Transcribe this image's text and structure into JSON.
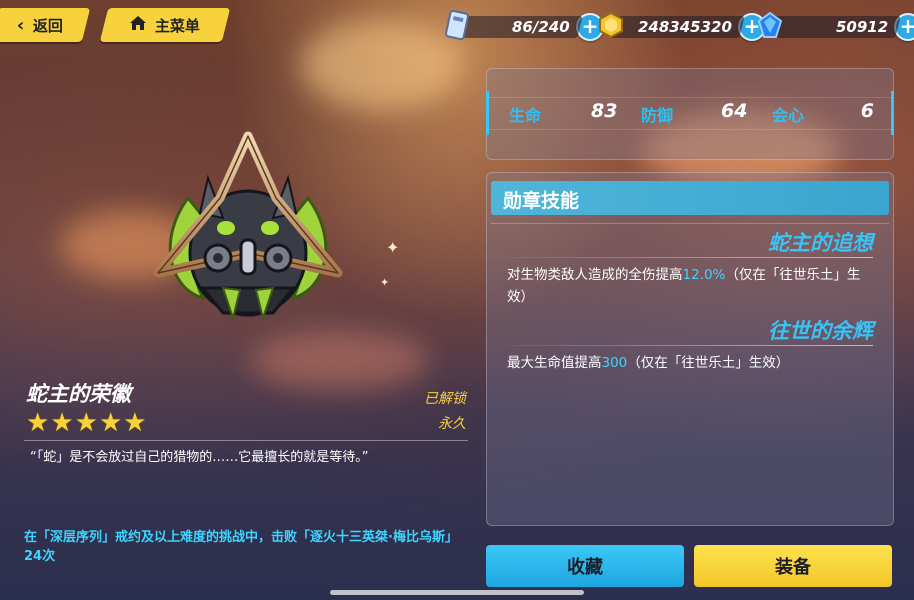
{
  "nav": {
    "back_label": "返回",
    "home_label": "主菜单"
  },
  "resources": [
    {
      "name": "stamina",
      "value": "86/240",
      "icon": "stamina-card-icon"
    },
    {
      "name": "coins",
      "value": "248345320",
      "icon": "gold-coin-icon"
    },
    {
      "name": "crystals",
      "value": "50912",
      "icon": "crystal-icon"
    }
  ],
  "stats": [
    {
      "label": "生命",
      "value": "83"
    },
    {
      "label": "防御",
      "value": "64"
    },
    {
      "label": "会心",
      "value": "6"
    }
  ],
  "skills": {
    "title": "勋章技能",
    "items": [
      {
        "name": "蛇主的追想",
        "desc_prefix": "对生物类敌人造成的全伤提高",
        "desc_highlight": "12.0%",
        "desc_suffix": "（仅在「往世乐土」生效）"
      },
      {
        "name": "往世的余辉",
        "desc_prefix": "最大生命值提高",
        "desc_highlight": "300",
        "desc_suffix": "（仅在「往世乐土」生效）"
      }
    ]
  },
  "medal": {
    "name": "蛇主的荣徽",
    "stars": 5,
    "status": "已解锁",
    "duration": "永久",
    "quote": "“「蛇」是不会放过自己的猎物的……它最擅长的就是等待。”",
    "condition": "在「深层序列」戒约及以上难度的挑战中，击败「逐火十三英桀·梅比乌斯」24次"
  },
  "actions": {
    "collect_label": "收藏",
    "equip_label": "装备"
  },
  "colors": {
    "accent_yellow": "#f7d23c",
    "accent_blue": "#2ec0f5"
  }
}
